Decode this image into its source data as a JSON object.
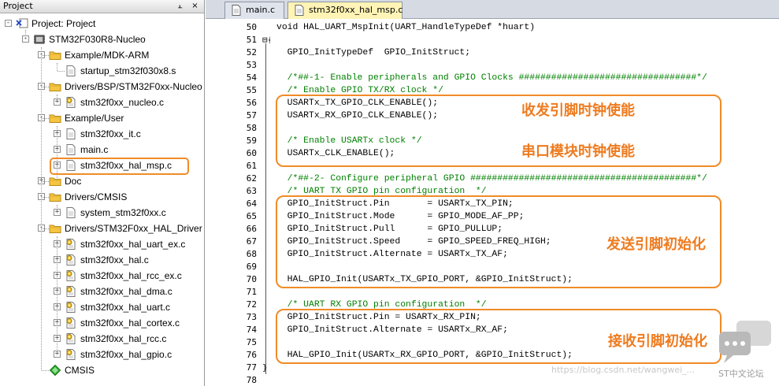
{
  "panel": {
    "title": "Project",
    "pin_glyph": "p",
    "close_glyph": "×"
  },
  "tree": [
    {
      "label": "Project: Project",
      "icon": "project-icon",
      "level": 0,
      "expander": "-"
    },
    {
      "label": "STM32F030R8-Nucleo",
      "icon": "target-icon",
      "level": 1,
      "expander": "-"
    },
    {
      "label": "Example/MDK-ARM",
      "icon": "folder-icon",
      "level": 2,
      "expander": "-"
    },
    {
      "label": "startup_stm32f030x8.s",
      "icon": "file-icon",
      "level": 3,
      "expander": ""
    },
    {
      "label": "Drivers/BSP/STM32F0xx-Nucleo",
      "icon": "folder-icon",
      "level": 2,
      "expander": "-"
    },
    {
      "label": "stm32f0xx_nucleo.c",
      "icon": "file-gear-icon",
      "level": 3,
      "expander": "+"
    },
    {
      "label": "Example/User",
      "icon": "folder-icon",
      "level": 2,
      "expander": "-"
    },
    {
      "label": "stm32f0xx_it.c",
      "icon": "file-icon",
      "level": 3,
      "expander": "+"
    },
    {
      "label": "main.c",
      "icon": "file-icon",
      "level": 3,
      "expander": "+"
    },
    {
      "label": "stm32f0xx_hal_msp.c",
      "icon": "file-icon",
      "level": 3,
      "expander": "+"
    },
    {
      "label": "Doc",
      "icon": "folder-icon",
      "level": 2,
      "expander": "+"
    },
    {
      "label": "Drivers/CMSIS",
      "icon": "folder-icon",
      "level": 2,
      "expander": "-"
    },
    {
      "label": "system_stm32f0xx.c",
      "icon": "file-icon",
      "level": 3,
      "expander": "+"
    },
    {
      "label": "Drivers/STM32F0xx_HAL_Driver",
      "icon": "folder-icon",
      "level": 2,
      "expander": "-"
    },
    {
      "label": "stm32f0xx_hal_uart_ex.c",
      "icon": "file-gear-icon",
      "level": 3,
      "expander": "+"
    },
    {
      "label": "stm32f0xx_hal.c",
      "icon": "file-gear-icon",
      "level": 3,
      "expander": "+"
    },
    {
      "label": "stm32f0xx_hal_rcc_ex.c",
      "icon": "file-gear-icon",
      "level": 3,
      "expander": "+"
    },
    {
      "label": "stm32f0xx_hal_dma.c",
      "icon": "file-gear-icon",
      "level": 3,
      "expander": "+"
    },
    {
      "label": "stm32f0xx_hal_uart.c",
      "icon": "file-gear-icon",
      "level": 3,
      "expander": "+"
    },
    {
      "label": "stm32f0xx_hal_cortex.c",
      "icon": "file-gear-icon",
      "level": 3,
      "expander": "+"
    },
    {
      "label": "stm32f0xx_hal_rcc.c",
      "icon": "file-gear-icon",
      "level": 3,
      "expander": "+"
    },
    {
      "label": "stm32f0xx_hal_gpio.c",
      "icon": "file-gear-icon",
      "level": 3,
      "expander": "+"
    },
    {
      "label": "CMSIS",
      "icon": "diamond-icon",
      "level": 2,
      "expander": ""
    }
  ],
  "tabs": [
    {
      "label": "main.c",
      "active": false
    },
    {
      "label": "stm32f0xx_hal_msp.c",
      "active": true
    }
  ],
  "code": [
    {
      "n": "50",
      "fold": "",
      "t": "void HAL_UART_MspInit(UART_HandleTypeDef *huart)",
      "c": false
    },
    {
      "n": "51",
      "fold": "⊟{",
      "t": "",
      "c": false
    },
    {
      "n": "52",
      "fold": "",
      "t": "  GPIO_InitTypeDef  GPIO_InitStruct;",
      "c": false
    },
    {
      "n": "53",
      "fold": "",
      "t": "",
      "c": false
    },
    {
      "n": "54",
      "fold": "",
      "t": "  /*##-1- Enable peripherals and GPIO Clocks #################################*/",
      "c": true
    },
    {
      "n": "55",
      "fold": "",
      "t": "  /* Enable GPIO TX/RX clock */",
      "c": true
    },
    {
      "n": "56",
      "fold": "",
      "t": "  USARTx_TX_GPIO_CLK_ENABLE();",
      "c": false
    },
    {
      "n": "57",
      "fold": "",
      "t": "  USARTx_RX_GPIO_CLK_ENABLE();",
      "c": false
    },
    {
      "n": "58",
      "fold": "",
      "t": "",
      "c": false
    },
    {
      "n": "59",
      "fold": "",
      "t": "  /* Enable USARTx clock */",
      "c": true
    },
    {
      "n": "60",
      "fold": "",
      "t": "  USARTx_CLK_ENABLE();",
      "c": false
    },
    {
      "n": "61",
      "fold": "",
      "t": "",
      "c": false
    },
    {
      "n": "62",
      "fold": "",
      "t": "  /*##-2- Configure peripheral GPIO ##########################################*/",
      "c": true
    },
    {
      "n": "63",
      "fold": "",
      "t": "  /* UART TX GPIO pin configuration  */",
      "c": true
    },
    {
      "n": "64",
      "fold": "",
      "t": "  GPIO_InitStruct.Pin       = USARTx_TX_PIN;",
      "c": false
    },
    {
      "n": "65",
      "fold": "",
      "t": "  GPIO_InitStruct.Mode      = GPIO_MODE_AF_PP;",
      "c": false
    },
    {
      "n": "66",
      "fold": "",
      "t": "  GPIO_InitStruct.Pull      = GPIO_PULLUP;",
      "c": false
    },
    {
      "n": "67",
      "fold": "",
      "t": "  GPIO_InitStruct.Speed     = GPIO_SPEED_FREQ_HIGH;",
      "c": false
    },
    {
      "n": "68",
      "fold": "",
      "t": "  GPIO_InitStruct.Alternate = USARTx_TX_AF;",
      "c": false
    },
    {
      "n": "69",
      "fold": "",
      "t": "",
      "c": false
    },
    {
      "n": "70",
      "fold": "",
      "t": "  HAL_GPIO_Init(USARTx_TX_GPIO_PORT, &GPIO_InitStruct);",
      "c": false
    },
    {
      "n": "71",
      "fold": "",
      "t": "",
      "c": false
    },
    {
      "n": "72",
      "fold": "",
      "t": "  /* UART RX GPIO pin configuration  */",
      "c": true
    },
    {
      "n": "73",
      "fold": "",
      "t": "  GPIO_InitStruct.Pin = USARTx_RX_PIN;",
      "c": false
    },
    {
      "n": "74",
      "fold": "",
      "t": "  GPIO_InitStruct.Alternate = USARTx_RX_AF;",
      "c": false
    },
    {
      "n": "75",
      "fold": "",
      "t": "",
      "c": false
    },
    {
      "n": "76",
      "fold": "",
      "t": "  HAL_GPIO_Init(USARTx_RX_GPIO_PORT, &GPIO_InitStruct);",
      "c": false
    },
    {
      "n": "77",
      "fold": "}",
      "t": "",
      "c": false
    },
    {
      "n": "78",
      "fold": "",
      "t": "",
      "c": false
    }
  ],
  "annotations": [
    {
      "label": "收发引脚时钟使能"
    },
    {
      "label": "串口模块时钟使能"
    },
    {
      "label": "发送引脚初始化"
    },
    {
      "label": "接收引脚初始化"
    }
  ],
  "watermark": {
    "url": "https://blog.csdn.net/wangwei_...",
    "brand": "ST中文论坛"
  },
  "colors": {
    "comment": "#008000",
    "annotation": "#f08b28",
    "tab_active": "#fff4b5"
  }
}
